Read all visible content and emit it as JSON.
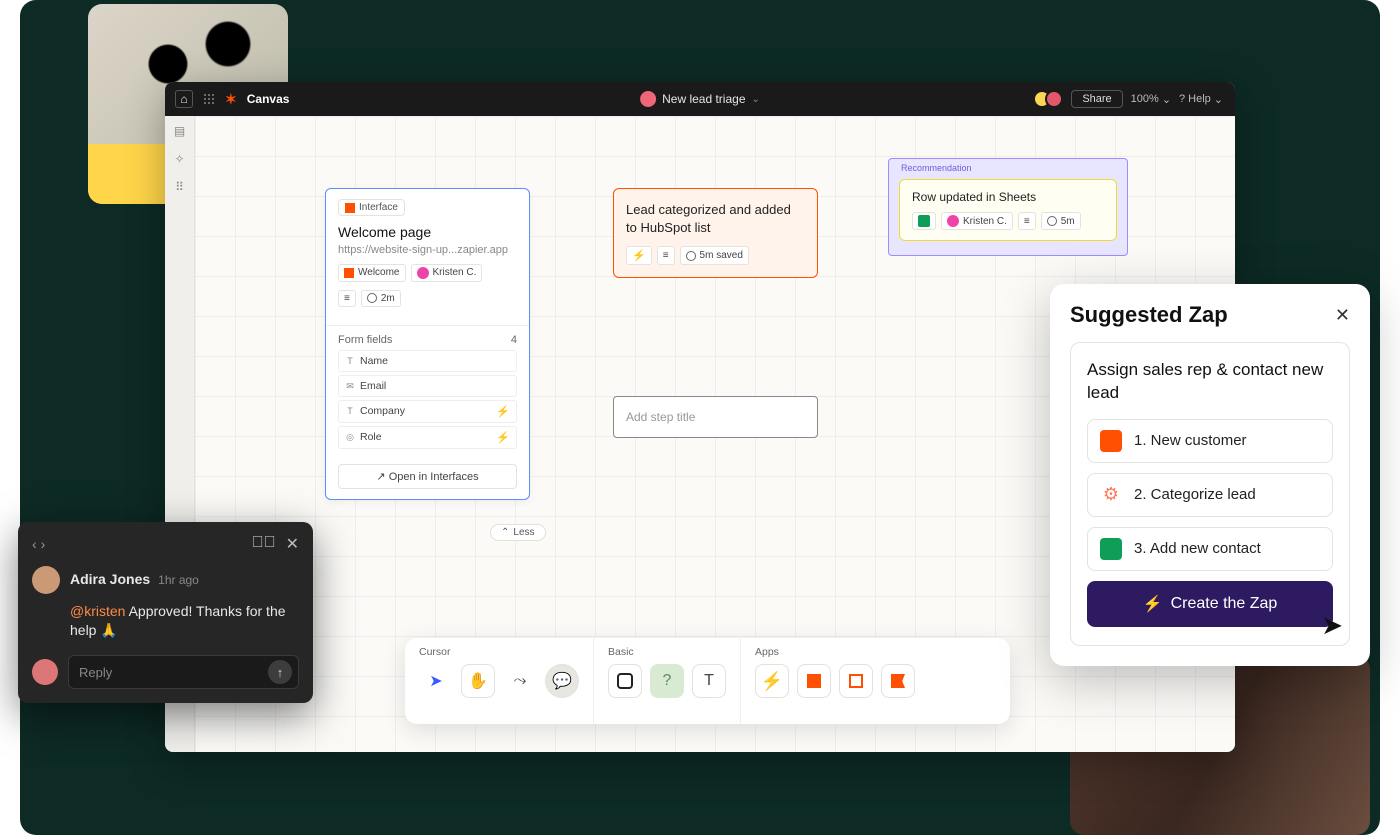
{
  "header": {
    "app_name": "Canvas",
    "doc_title": "New lead triage",
    "share_label": "Share",
    "zoom": "100%",
    "help_label": "Help"
  },
  "node_interface": {
    "badge": "Interface",
    "title": "Welcome page",
    "url": "https://website-sign-up...zapier.app",
    "chip_welcome": "Welcome",
    "chip_owner": "Kristen C.",
    "chip_time": "2m",
    "form_fields_label": "Form fields",
    "form_fields_count": "4",
    "fields": [
      {
        "type": "T",
        "label": "Name",
        "bolt": false
      },
      {
        "type": "✉",
        "label": "Email",
        "bolt": false
      },
      {
        "type": "T",
        "label": "Company",
        "bolt": true
      },
      {
        "type": "◎",
        "label": "Role",
        "bolt": true
      }
    ],
    "open_label": "Open in Interfaces",
    "less_label": "Less"
  },
  "node_lead": {
    "title": "Lead categorized and added to HubSpot list",
    "chip_time": "5m saved"
  },
  "add_step_placeholder": "Add step title",
  "recommendation": {
    "label": "Recommendation",
    "title": "Row updated in Sheets",
    "chip_owner": "Kristen C.",
    "chip_time": "5m"
  },
  "bottom_toolbar": {
    "cursor_label": "Cursor",
    "basic_label": "Basic",
    "apps_label": "Apps"
  },
  "comment": {
    "author": "Adira Jones",
    "time": "1hr ago",
    "mention": "@kristen",
    "body_rest": " Approved! Thanks for the help 🙏",
    "reply_placeholder": "Reply"
  },
  "suggested": {
    "heading": "Suggested Zap",
    "title": "Assign sales rep & contact new lead",
    "steps": [
      "1. New customer",
      "2. Categorize lead",
      "3. Add new contact"
    ],
    "cta": "Create the Zap"
  }
}
